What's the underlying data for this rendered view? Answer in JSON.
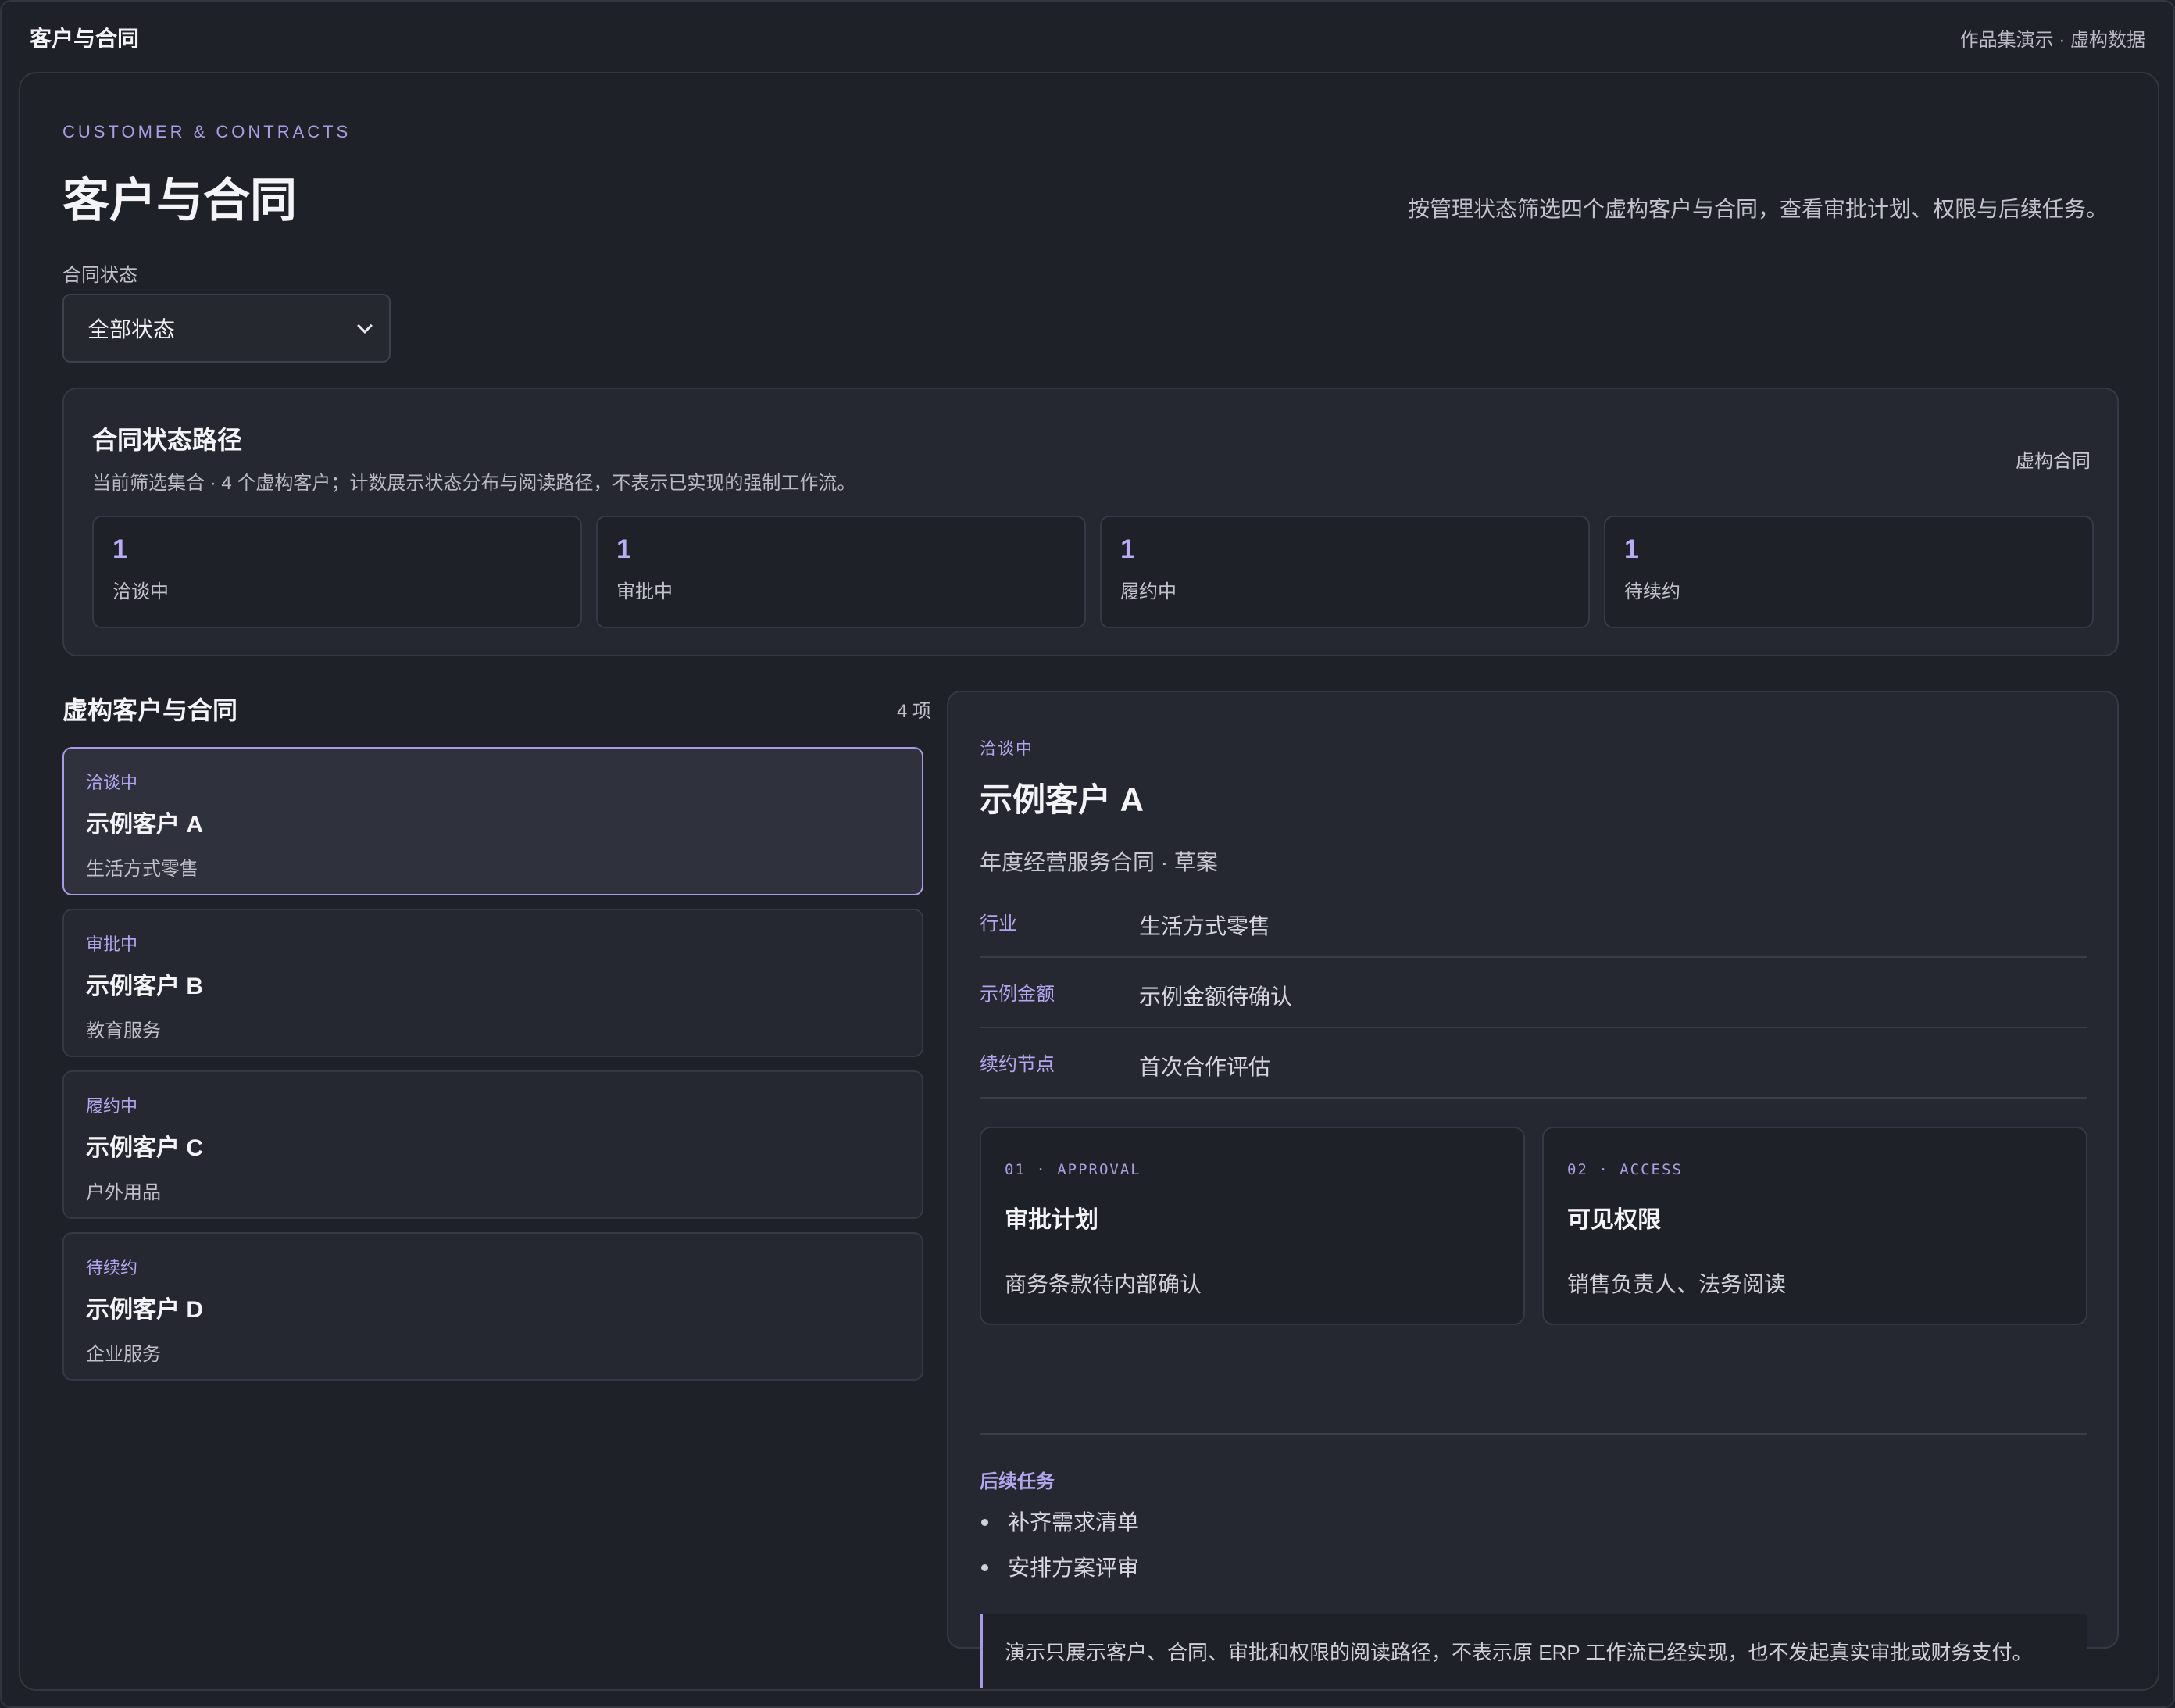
{
  "window": {
    "title": "客户与合同",
    "meta": "作品集演示 · 虚构数据"
  },
  "header": {
    "kicker": "CUSTOMER & CONTRACTS",
    "title": "客户与合同",
    "description": "按管理状态筛选四个虚构客户与合同，查看审批计划、权限与后续任务。"
  },
  "filter": {
    "label": "合同状态",
    "selected": "全部状态"
  },
  "status_path": {
    "title": "合同状态路径",
    "description": "当前筛选集合 · 4 个虚构客户；计数展示状态分布与阅读路径，不表示已实现的强制工作流。",
    "tag": "虚构合同",
    "stats": [
      {
        "count": "1",
        "label": "洽谈中"
      },
      {
        "count": "1",
        "label": "审批中"
      },
      {
        "count": "1",
        "label": "履约中"
      },
      {
        "count": "1",
        "label": "待续约"
      }
    ]
  },
  "customer_list": {
    "title": "虚构客户与合同",
    "count": "4 项",
    "items": [
      {
        "status": "洽谈中",
        "name": "示例客户 A",
        "industry": "生活方式零售",
        "selected": true
      },
      {
        "status": "审批中",
        "name": "示例客户 B",
        "industry": "教育服务",
        "selected": false
      },
      {
        "status": "履约中",
        "name": "示例客户 C",
        "industry": "户外用品",
        "selected": false
      },
      {
        "status": "待续约",
        "name": "示例客户 D",
        "industry": "企业服务",
        "selected": false
      }
    ]
  },
  "detail": {
    "status": "洽谈中",
    "name": "示例客户 A",
    "contract": "年度经营服务合同 · 草案",
    "rows": [
      {
        "key": "行业",
        "value": "生活方式零售"
      },
      {
        "key": "示例金额",
        "value": "示例金额待确认"
      },
      {
        "key": "续约节点",
        "value": "首次合作评估"
      }
    ],
    "cards": [
      {
        "kicker": "01 · APPROVAL",
        "title": "审批计划",
        "text": "商务条款待内部确认"
      },
      {
        "kicker": "02 · ACCESS",
        "title": "可见权限",
        "text": "销售负责人、法务阅读"
      }
    ],
    "tasks_title": "后续任务",
    "tasks": [
      "补齐需求清单",
      "安排方案评审"
    ],
    "note": "演示只展示客户、合同、审批和权限的阅读路径，不表示原 ERP 工作流已经实现，也不发起真实审批或财务支付。"
  },
  "colors": {
    "background": "#1f2128",
    "panel": "#262831",
    "accent": "#a79be6",
    "text": "#f4f4f8"
  }
}
